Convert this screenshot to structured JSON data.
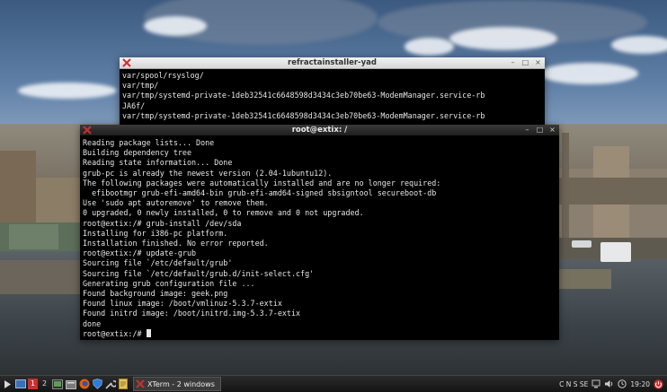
{
  "window_back": {
    "title": "refractainstaller-yad",
    "lines": [
      "var/spool/rsyslog/",
      "var/tmp/",
      "var/tmp/systemd-private-1deb32541c6648598d3434c3eb70be63-ModemManager.service-rb",
      "JA6f/",
      "var/tmp/systemd-private-1deb32541c6648598d3434c3eb70be63-ModemManager.service-rb"
    ]
  },
  "window_front": {
    "title": "root@extix: /",
    "lines": [
      "Reading package lists... Done",
      "Building dependency tree",
      "Reading state information... Done",
      "grub-pc is already the newest version (2.04-1ubuntu12).",
      "The following packages were automatically installed and are no longer required:",
      "  efibootmgr grub-efi-amd64-bin grub-efi-amd64-signed sbsigntool secureboot-db",
      "Use 'sudo apt autoremove' to remove them.",
      "0 upgraded, 0 newly installed, 0 to remove and 0 not upgraded.",
      "root@extix:/# grub-install /dev/sda",
      "Installing for i386-pc platform.",
      "Installation finished. No error reported.",
      "root@extix:/# update-grub",
      "Sourcing file `/etc/default/grub'",
      "Sourcing file `/etc/default/grub.d/init-select.cfg'",
      "Generating grub configuration file ...",
      "Found background image: geek.png",
      "Found linux image: /boot/vmlinuz-5.3.7-extix",
      "Found initrd image: /boot/initrd.img-5.3.7-extix",
      "done"
    ],
    "prompt": "root@extix:/# "
  },
  "titlebar_buttons": {
    "minimize": "–",
    "maximize": "□",
    "close": "×"
  },
  "taskbar": {
    "workspaces": [
      "1",
      "2"
    ],
    "task_label": "XTerm - 2 windows",
    "keyboard_indicator": "C N S SE",
    "clock": "19:20"
  },
  "colors": {
    "accent": "#c8312f",
    "terminal_bg": "#000000",
    "terminal_fg": "#e6e6e6"
  }
}
